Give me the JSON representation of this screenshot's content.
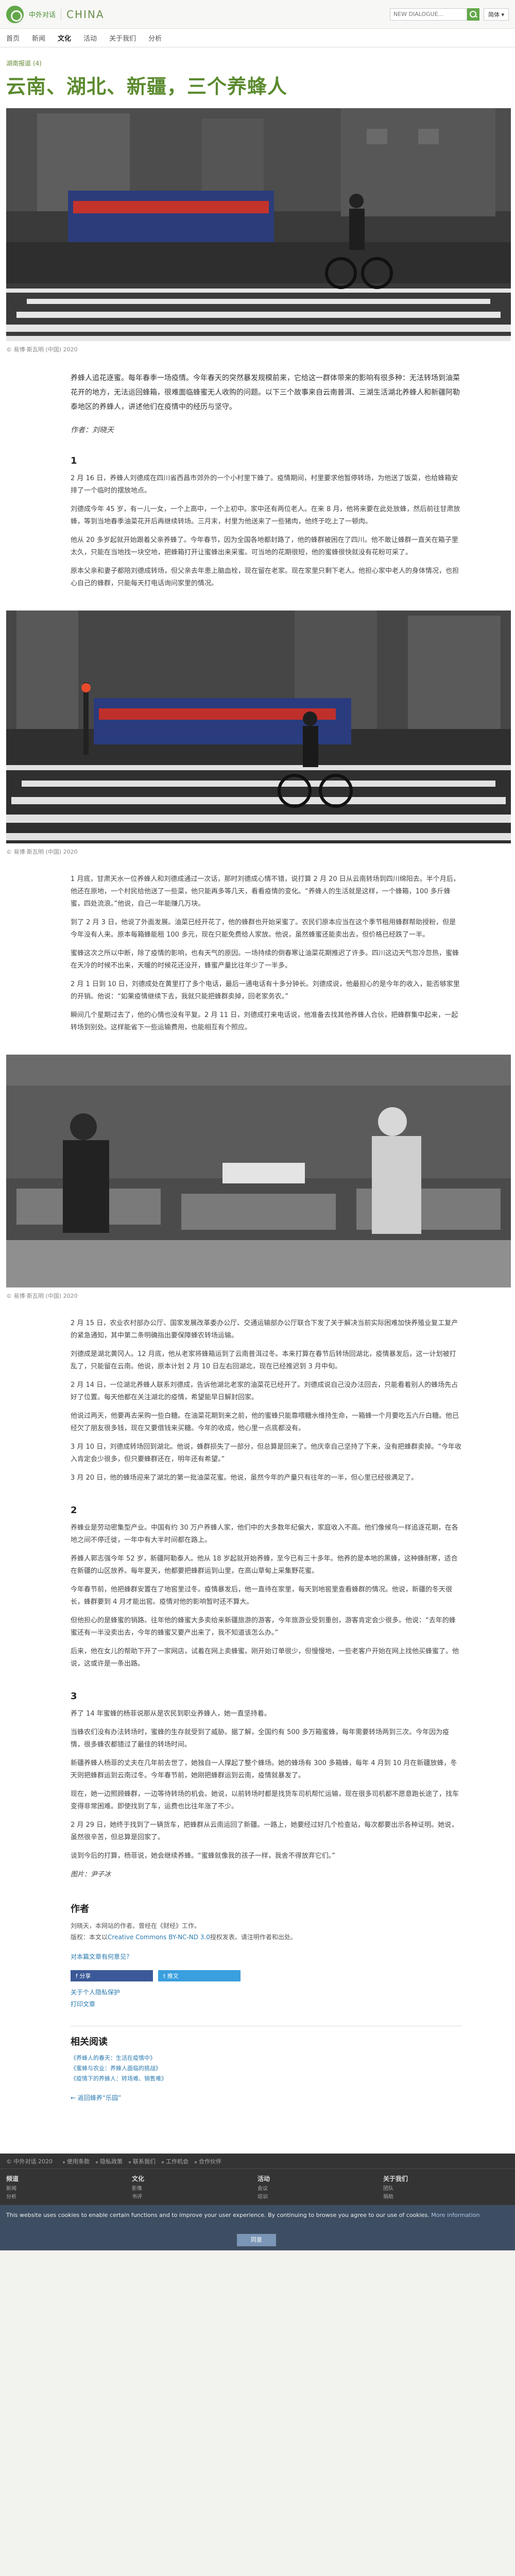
{
  "header": {
    "site_name": "中外对话",
    "title": "CHINA",
    "search_placeholder": "NEW DIALOGUE...",
    "language": "简体 ▾"
  },
  "nav": {
    "items": [
      "首页",
      "新闻",
      "文化",
      "活动",
      "关于我们",
      "分析"
    ],
    "active_index": 2
  },
  "article": {
    "category": "湖南报道 (4)",
    "title": "云南、湖北、新疆，三个养蜂人",
    "photos": [
      {
        "caption": "© 易博·斯瓦明 (中国) 2020"
      },
      {
        "caption": "© 易博·斯瓦明 (中国) 2020"
      },
      {
        "caption": "© 易博·斯瓦明 (中国) 2020"
      }
    ],
    "lead": "养蜂人追花逐蜜。每年春季一场疫情。今年春天的突然暴发规模前来，它给这一群体带来的影响有很多种：无法转场到油菜花开的地方，无法运回蜂箱，很难面临蜂蜜无人收购的问题。以下三个故事来自云南普洱、三湖生活湖北养蜂人和新疆阿勒泰地区的养蜂人，讲述他们在疫情中的经历与坚守。",
    "author_line": "作者：刘晓天",
    "sections": [
      {
        "number": "1",
        "paragraphs": [
          "2 月 16 日，养蜂人刘德成在四川省西昌市郊外的一个小村里下蜂了。疫情期间，村里要求他暂停转场，为他送了饭菜，也给蜂箱安排了一个临时的摆放地点。",
          "刘德成今年 45 岁，有一儿一女，一个上高中，一个上初中。家中还有两位老人。在来 8 月，他将来要在此处放蜂，然后前往甘肃放蜂，等到当地春季油菜花开后再继续转场。三月末，村里为他送来了一些猪肉，他终于吃上了一顿肉。",
          "他从 20 多岁起就开始跟着父亲养蜂了。今年春节，因为全国各地都封路了，他的蜂群被困在了四川。他不敢让蜂群一直关在箱子里太久，只能在当地找一块空地，把蜂箱打开让蜜蜂出来采蜜。可当地的花期很短，他的蜜蜂很快就没有花粉可采了。",
          "原本父亲和妻子都陪刘德成转场，但父亲去年患上脑血栓，现在留在老家。现在家里只剩下老人。他担心家中老人的身体情况，也担心自己的蜂群，只能每天打电话询问家里的情况。"
        ]
      },
      {
        "number": "",
        "paragraphs": [
          "1 月底，甘肃天水一位养蜂人和刘德成通过一次话，那时刘德成心情不错，说打算 2 月 20 日从云南转场到四川绵阳去。半个月后，他还在原地，一个村民给他送了一些菜，他只能再多等几天，看看疫情的变化。“养蜂人的生活就是这样，一个蜂箱，100 多斤蜂蜜，四处流浪。”他说，自己一年能赚几万块。",
          "到了 2 月 3 日，他说了外面发展。油菜已经开花了，他的蜂群也开始采蜜了。农民们原本应当在这个季节租用蜂群帮助授粉，但是今年没有人来。原本每箱蜂能租 100 多元，现在只能免费给人家放。他说，虽然蜂蜜还能卖出去，但价格已经跌了一半。",
          "蜜蜂这次之所以中断，除了疫情的影响，也有天气的原因。一场持续的倒春寒让油菜花期推迟了许多。四川这边天气忽冷忽热，蜜蜂在天冷的时候不出来，天暖的时候花还没开，蜂蜜产量比往年少了一半多。",
          "2 月 1 日到 10 日，刘德成处在黄里打了多个电话，最后一通电话有十多分钟长。刘德成说，他最担心的是今年的收入，能否够家里的开销。他说：“如果疫情继续下去，我就只能把蜂群卖掉，回老家务农。”",
          "瞬间几个星期过去了，他的心情也没有平复。2 月 11 日，刘德成打来电话说，他准备去找其他养蜂人合伙，把蜂群集中起来，一起转场到别处。这样能省下一些运输费用，也能相互有个照应。"
        ]
      },
      {
        "number": "",
        "paragraphs": [
          "2 月 15 日，农业农村部办公厅、国家发展改革委办公厅、交通运输部办公厅联合下发了关于解决当前实际困难加快养殖业复工复产的紧急通知，其中第二条明确指出要保障蜂农转场运输。",
          "刘德成是湖北黄冈人。12 月底，他从老家将蜂箱运到了云南普洱过冬。本来打算在春节后转场回湖北，疫情暴发后，这一计划被打乱了，只能留在云南。他说，原本计划 2 月 10 日左右回湖北，现在已经推迟到 3 月中旬。",
          "2 月 14 日，一位湖北养蜂人联系刘德成，告诉他湖北老家的油菜花已经开了。刘德成说自己没办法回去，只能看着别人的蜂场先占好了位置。每天他都在关注湖北的疫情，希望能早日解封回家。",
          "他说过两天，他要再去采购一些白糖。在油菜花期到来之前，他的蜜蜂只能靠喂糖水维持生命，一箱蜂一个月要吃五六斤白糖。他已经欠了朋友很多钱，现在又要借钱来买糖。今年的收成，他心里一点底都没有。",
          "3 月 10 日，刘德成转场回到湖北。他说，蜂群损失了一部分，但总算是回来了。他庆幸自己坚持了下来，没有把蜂群卖掉。“今年收入肯定会少很多，但只要蜂群还在，明年还有希望。”",
          "3 月 20 日，他的蜂场迎来了湖北的第一批油菜花蜜。他说，虽然今年的产量只有往年的一半，但心里已经很满足了。"
        ]
      },
      {
        "number": "2",
        "paragraphs": [
          "养蜂业是劳动密集型产业。中国有约 30 万户养蜂人家，他们中的大多数年纪偏大，家庭收入不高。他们像候鸟一样追逐花期，在各地之间不停迁徙，一年中有大半时间都在路上。",
          "养蜂人郭志强今年 52 岁，新疆阿勒泰人。他从 18 岁起就开始养蜂，至今已有三十多年。他养的是本地的黑蜂，这种蜂耐寒，适合在新疆的山区放养。每年夏天，他都要把蜂群运到山里，在高山草甸上采集野花蜜。",
          "今年春节前，他把蜂群安置在了地窖里过冬。疫情暴发后，他一直待在家里，每天到地窖里查看蜂群的情况。他说，新疆的冬天很长，蜂群要到 4 月才能出窖。疫情对他的影响暂时还不算大。",
          "但他担心的是蜂蜜的销路。往年他的蜂蜜大多卖给来新疆旅游的游客，今年旅游业受到重创，游客肯定会少很多。他说：“去年的蜂蜜还有一半没卖出去，今年的蜂蜜又要产出来了，我不知道该怎么办。”",
          "后来，他在女儿的帮助下开了一家网店，试着在网上卖蜂蜜。刚开始订单很少，但慢慢地，一些老客户开始在网上找他买蜂蜜了。他说，这或许是一条出路。"
        ]
      },
      {
        "number": "3",
        "paragraphs": [
          "养了 14 年蜜蜂的杨菲说那从是农民到职业养蜂人，她一直坚持着。",
          "当蜂农们没有办法转场时，蜜蜂的生存就受到了威胁。据了解，全国约有 500 多万箱蜜蜂，每年需要转场两到三次。今年因为疫情，很多蜂农都错过了最佳的转场时间。",
          "新疆养蜂人杨菲的丈夫在几年前去世了，她独自一人撑起了整个蜂场。她的蜂场有 300 多箱蜂，每年 4 月到 10 月在新疆放蜂，冬天则把蜂群运到云南过冬。今年春节前，她刚把蜂群运到云南，疫情就暴发了。",
          "现在，她一边照顾蜂群，一边等待转场的机会。她说，以前转场时都是找货车司机帮忙运输，现在很多司机都不愿意跑长途了，找车变得非常困难。即使找到了车，运费也比往年涨了不少。",
          "2 月 29 日，她终于找到了一辆货车，把蜂群从云南运回了新疆。一路上，她要经过好几个检查站，每次都要出示各种证明。她说，虽然很辛苦，但总算是回家了。",
          "谈到今后的打算，杨菲说，她会继续养蜂。“蜜蜂就像我的孩子一样，我舍不得放弃它们。”"
        ]
      }
    ],
    "photo_credit": "图片：尹子冰"
  },
  "author_box": {
    "heading": "作者",
    "bio": "刘晓天，本网站的作者。曾经在《财经》工作。",
    "license_prefix": "版权：本文以",
    "license_link": "Creative Commons BY-NC-ND 3.0",
    "license_suffix": "授权发表。请注明作者和出处。",
    "feedback": "对本篇文章有何意见？"
  },
  "share": {
    "facebook": "f 分享",
    "twitter": "t 推文"
  },
  "meta_links": [
    "关于个人隐私保护",
    "打印文章"
  ],
  "related": {
    "heading": "相关阅读",
    "items": [
      "《养蜂人的春天：生活在疫情中》",
      "《蜜蜂与农业：养蜂人面临的挑战》",
      "《疫情下的养蜂人：转场难、销售难》"
    ],
    "back": "← 返回蜂养“乐园”"
  },
  "footer": {
    "copyright": "© 中外对话 2020",
    "links": [
      "使用条款",
      "隐私政策",
      "联系我们",
      "工作机会",
      "合作伙伴"
    ],
    "columns": [
      {
        "heading": "频道",
        "items": [
          "新闻",
          "分析",
          "评论",
          "专题"
        ]
      },
      {
        "heading": "文化",
        "items": [
          "影像",
          "书评",
          "访谈"
        ]
      },
      {
        "heading": "活动",
        "items": [
          "会议",
          "培训"
        ]
      },
      {
        "heading": "关于我们",
        "items": [
          "团队",
          "捐助",
          "订阅"
        ]
      }
    ]
  },
  "cookie_banner": {
    "text": "This website uses cookies to enable certain functions and to improve your user experience. By continuing to browse you agree to our use of cookies.",
    "more": "More information",
    "accept": "同意"
  }
}
